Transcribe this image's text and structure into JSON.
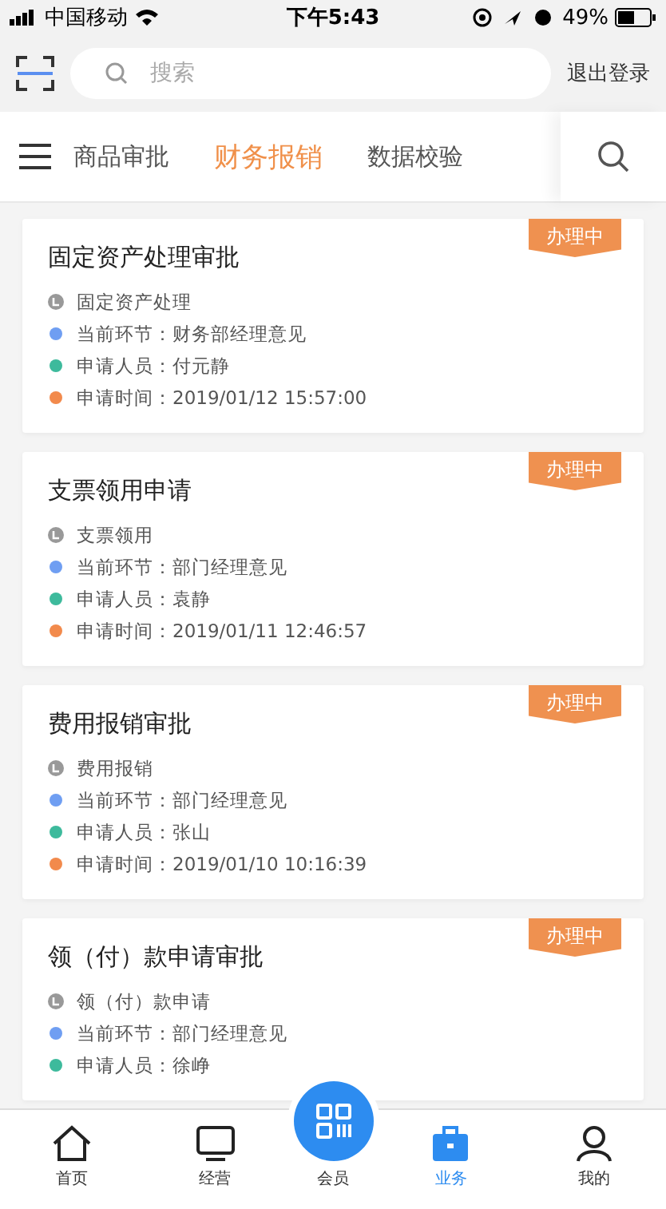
{
  "status_bar": {
    "carrier": "中国移动",
    "time": "下午5:43",
    "battery": "49%"
  },
  "header": {
    "search": {
      "placeholder": "搜索"
    },
    "logout": "退出登录"
  },
  "tabs": [
    {
      "label": "商品审批",
      "selected": false
    },
    {
      "label": "财务报销",
      "selected": true
    },
    {
      "label": "数据校验",
      "selected": false
    }
  ],
  "cards": [
    {
      "title": "固定资产处理审批",
      "badge": "办理中",
      "rows": [
        {
          "kind": "category",
          "text": "固定资产处理"
        },
        {
          "kind": "dot",
          "color": "#6f9ef2",
          "text": "当前环节：财务部经理意见"
        },
        {
          "kind": "dot",
          "color": "#3dba9c",
          "text": "申请人员：付元静"
        },
        {
          "kind": "dot",
          "color": "#f28a4c",
          "text": "申请时间：2019/01/12 15:57:00"
        }
      ]
    },
    {
      "title": "支票领用申请",
      "badge": "办理中",
      "rows": [
        {
          "kind": "category",
          "text": "支票领用"
        },
        {
          "kind": "dot",
          "color": "#6f9ef2",
          "text": "当前环节：部门经理意见"
        },
        {
          "kind": "dot",
          "color": "#3dba9c",
          "text": "申请人员：袁静"
        },
        {
          "kind": "dot",
          "color": "#f28a4c",
          "text": "申请时间：2019/01/11 12:46:57"
        }
      ]
    },
    {
      "title": "费用报销审批",
      "badge": "办理中",
      "rows": [
        {
          "kind": "category",
          "text": "费用报销"
        },
        {
          "kind": "dot",
          "color": "#6f9ef2",
          "text": "当前环节：部门经理意见"
        },
        {
          "kind": "dot",
          "color": "#3dba9c",
          "text": "申请人员：张山"
        },
        {
          "kind": "dot",
          "color": "#f28a4c",
          "text": "申请时间：2019/01/10 10:16:39"
        }
      ]
    },
    {
      "title": "领（付）款申请审批",
      "badge": "办理中",
      "rows": [
        {
          "kind": "category",
          "text": "领（付）款申请"
        },
        {
          "kind": "dot",
          "color": "#6f9ef2",
          "text": "当前环节：部门经理意见"
        },
        {
          "kind": "dot",
          "color": "#3dba9c",
          "text": "申请人员：徐峥"
        }
      ]
    }
  ],
  "tab_bar": [
    {
      "kind": "home",
      "label": "首页",
      "selected": false
    },
    {
      "kind": "monitor",
      "label": "经营",
      "selected": false
    },
    {
      "kind": "qr",
      "label": "会员",
      "selected": false
    },
    {
      "kind": "briefcase",
      "label": "业务",
      "selected": true
    },
    {
      "kind": "person",
      "label": "我的",
      "selected": false
    }
  ]
}
